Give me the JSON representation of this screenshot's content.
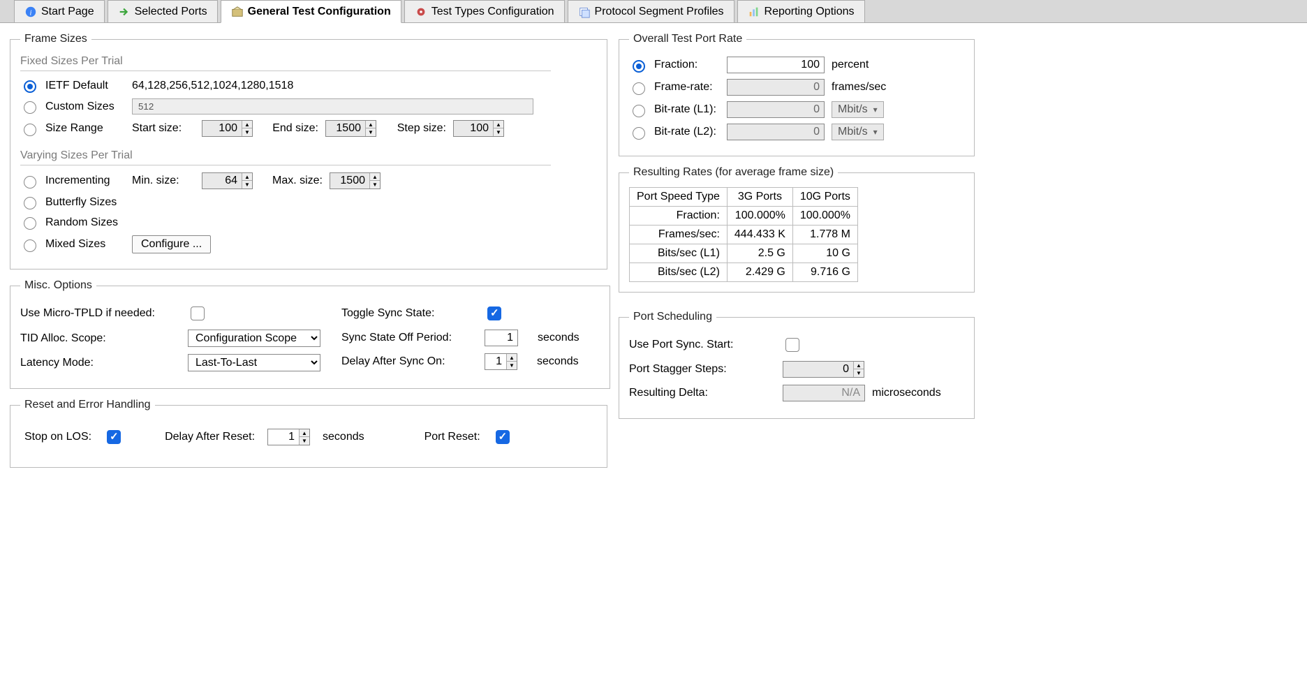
{
  "tabs": {
    "start": "Start Page",
    "ports": "Selected Ports",
    "general": "General Test Configuration",
    "types": "Test Types Configuration",
    "profiles": "Protocol Segment Profiles",
    "reporting": "Reporting Options"
  },
  "frameSizes": {
    "legend": "Frame Sizes",
    "fixedTitle": "Fixed Sizes Per Trial",
    "ietfLabel": "IETF Default",
    "ietfValues": "64,128,256,512,1024,1280,1518",
    "customLabel": "Custom Sizes",
    "customValue": "512",
    "rangeLabel": "Size Range",
    "startSizeLabel": "Start size:",
    "startSize": "100",
    "endSizeLabel": "End size:",
    "endSize": "1500",
    "stepSizeLabel": "Step size:",
    "stepSize": "100",
    "varyingTitle": "Varying Sizes Per Trial",
    "incLabel": "Incrementing",
    "minSizeLabel": "Min. size:",
    "minSize": "64",
    "maxSizeLabel": "Max. size:",
    "maxSize": "1500",
    "butterflyLabel": "Butterfly Sizes",
    "randomLabel": "Random Sizes",
    "mixedLabel": "Mixed Sizes",
    "configureBtn": "Configure ..."
  },
  "rate": {
    "legend": "Overall Test Port Rate",
    "fractionLabel": "Fraction:",
    "fractionValue": "100",
    "fractionUnit": "percent",
    "frameRateLabel": "Frame-rate:",
    "frameRateValue": "0",
    "frameRateUnit": "frames/sec",
    "l1Label": "Bit-rate (L1):",
    "l1Value": "0",
    "l1Unit": "Mbit/s",
    "l2Label": "Bit-rate (L2):",
    "l2Value": "0",
    "l2Unit": "Mbit/s"
  },
  "resulting": {
    "legend": "Resulting Rates (for average frame size)",
    "h1": "Port Speed Type",
    "h2": "3G Ports",
    "h3": "10G Ports",
    "rows": [
      {
        "label": "Fraction:",
        "c1": "100.000%",
        "c2": "100.000%"
      },
      {
        "label": "Frames/sec:",
        "c1": "444.433 K",
        "c2": "1.778 M"
      },
      {
        "label": "Bits/sec (L1)",
        "c1": "2.5 G",
        "c2": "10 G"
      },
      {
        "label": "Bits/sec (L2)",
        "c1": "2.429 G",
        "c2": "9.716 G"
      }
    ]
  },
  "misc": {
    "legend": "Misc. Options",
    "tpldLabel": "Use Micro-TPLD if needed:",
    "tidLabel": "TID Alloc. Scope:",
    "tidValue": "Configuration Scope",
    "latencyLabel": "Latency Mode:",
    "latencyValue": "Last-To-Last",
    "toggleLabel": "Toggle Sync State:",
    "offLabel": "Sync State Off Period:",
    "offValue": "1",
    "offUnit": "seconds",
    "delayOnLabel": "Delay After Sync On:",
    "delayOnValue": "1",
    "delayOnUnit": "seconds"
  },
  "schedule": {
    "legend": "Port Scheduling",
    "syncLabel": "Use Port Sync. Start:",
    "staggerLabel": "Port Stagger Steps:",
    "staggerValue": "0",
    "deltaLabel": "Resulting Delta:",
    "deltaValue": "N/A",
    "deltaUnit": "microseconds"
  },
  "reset": {
    "legend": "Reset and Error Handling",
    "stopLabel": "Stop on LOS:",
    "delayLabel": "Delay After Reset:",
    "delayValue": "1",
    "delayUnit": "seconds",
    "portResetLabel": "Port Reset:"
  }
}
